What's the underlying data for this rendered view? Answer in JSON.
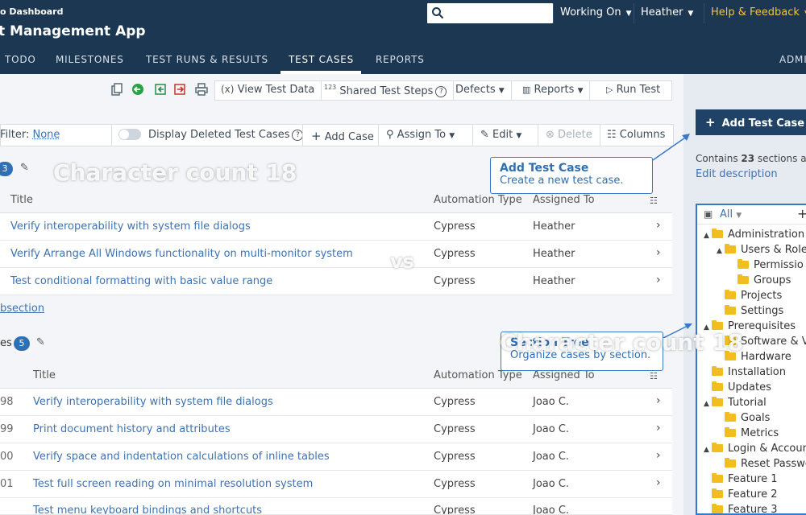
{
  "header": {
    "back_link": "o Dashboard",
    "app_title": "t Management App",
    "working_on": "Working On",
    "user": "Heather",
    "help": "Help & Feedback"
  },
  "nav": [
    {
      "label": "TODO",
      "active": false
    },
    {
      "label": "MILESTONES",
      "active": false
    },
    {
      "label": "TEST RUNS & RESULTS",
      "active": false
    },
    {
      "label": "TEST CASES",
      "active": true
    },
    {
      "label": "REPORTS",
      "active": false
    },
    {
      "label": "ADMI",
      "active": false
    }
  ],
  "toolbar": {
    "view_test_data": "View Test Data",
    "shared_steps": "Shared Test Steps",
    "defects": "Defects",
    "reports": "Reports",
    "run_test": "Run Test"
  },
  "filterbar": {
    "filter_label": "Filter:",
    "filter_value": "None",
    "display_deleted": "Display Deleted Test Cases",
    "add_case": "Add Case",
    "assign_to": "Assign To",
    "edit": "Edit",
    "delete": "Delete",
    "columns": "Columns"
  },
  "sections": [
    {
      "name": "",
      "count": "3",
      "header": {
        "title": "Title",
        "automation": "Automation Type",
        "assigned": "Assigned To"
      },
      "rows": [
        {
          "id": "",
          "title": "Verify interoperability with system file dialogs",
          "automation": "Cypress",
          "assigned": "Heather"
        },
        {
          "id": "",
          "title": "Verify Arrange All Windows functionality on multi-monitor system",
          "automation": "Cypress",
          "assigned": "Heather"
        },
        {
          "id": "",
          "title": "Test conditional formatting with basic value range",
          "automation": "Cypress",
          "assigned": "Heather"
        }
      ],
      "add_subsection": "bsection"
    },
    {
      "name": "es",
      "count": "5",
      "header": {
        "title": "Title",
        "automation": "Automation Type",
        "assigned": "Assigned To"
      },
      "rows": [
        {
          "id": "98",
          "title": "Verify interoperability with system file dialogs",
          "automation": "Cypress",
          "assigned": "Joao C."
        },
        {
          "id": "99",
          "title": "Print document history and attributes",
          "automation": "Cypress",
          "assigned": "Joao C."
        },
        {
          "id": "00",
          "title": "Verify space and indentation calculations of inline tables",
          "automation": "Cypress",
          "assigned": "Joao C."
        },
        {
          "id": "01",
          "title": "Test full screen reading on minimal resolution system",
          "automation": "Cypress",
          "assigned": "Joao C."
        },
        {
          "id": "",
          "title": "Test menu keyboard bindings and shortcuts",
          "automation": "Cypress",
          "assigned": "Joao C."
        }
      ]
    }
  ],
  "right_panel": {
    "add_test_case": "Add Test Case",
    "contains_prefix": "Contains ",
    "contains_count": "23",
    "contains_suffix": " sections ar",
    "edit_description": "Edit description",
    "tree_filter": "All",
    "tree": [
      {
        "label": "Administration",
        "level": 0,
        "toggle": "▲"
      },
      {
        "label": "Users & Roles",
        "level": 1,
        "toggle": "▲"
      },
      {
        "label": "Permissio",
        "level": 2,
        "toggle": ""
      },
      {
        "label": "Groups",
        "level": 2,
        "toggle": ""
      },
      {
        "label": "Projects",
        "level": 1,
        "toggle": ""
      },
      {
        "label": "Settings",
        "level": 1,
        "toggle": ""
      },
      {
        "label": "Prerequisites",
        "level": 0,
        "toggle": "▲"
      },
      {
        "label": "Software & V",
        "level": 1,
        "toggle": ""
      },
      {
        "label": "Hardware",
        "level": 1,
        "toggle": ""
      },
      {
        "label": "Installation",
        "level": 0,
        "toggle": ""
      },
      {
        "label": "Updates",
        "level": 0,
        "toggle": ""
      },
      {
        "label": "Tutorial",
        "level": 0,
        "toggle": "▲"
      },
      {
        "label": "Goals",
        "level": 1,
        "toggle": ""
      },
      {
        "label": "Metrics",
        "level": 1,
        "toggle": ""
      },
      {
        "label": "Login & Account",
        "level": 0,
        "toggle": "▲"
      },
      {
        "label": "Reset Passwo",
        "level": 1,
        "toggle": ""
      },
      {
        "label": "Feature 1",
        "level": 0,
        "toggle": ""
      },
      {
        "label": "Feature 2",
        "level": 0,
        "toggle": ""
      },
      {
        "label": "Feature 3",
        "level": 0,
        "toggle": ""
      }
    ]
  },
  "callouts": {
    "add_test_case": {
      "title": "Add Test Case",
      "desc": "Create a new test case."
    },
    "section_tree": {
      "title": "Section Tree",
      "desc": "Organize cases by section."
    }
  },
  "overlay": {
    "text_a": "Character count 18",
    "vs": "vs",
    "text_b": "Character count 18"
  },
  "colors": {
    "header": "#1b3752",
    "accent": "#2f6fb3",
    "help": "#f5c242",
    "folder": "#f2bd1f"
  }
}
